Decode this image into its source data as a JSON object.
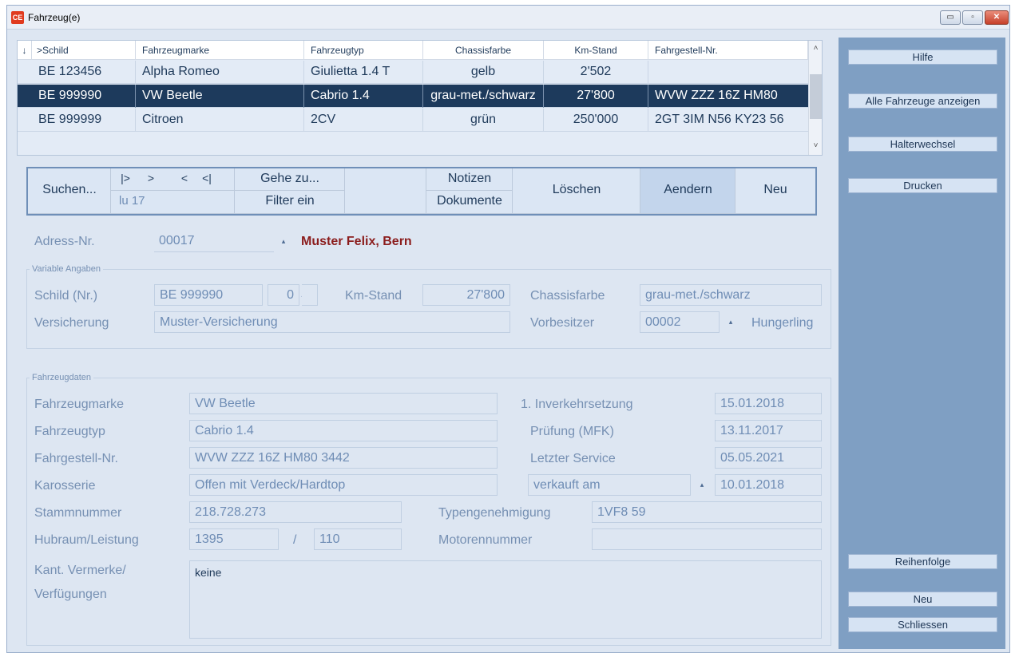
{
  "window": {
    "title": "Fahrzeug(e)",
    "icon": "app-logo-icon",
    "btn_min": "▭",
    "btn_max": "▫",
    "btn_close": "✕"
  },
  "grid": {
    "sort_indicator": "↓",
    "headers": [
      ">Schild",
      "Fahrzeugmarke",
      "Fahrzeugtyp",
      "Chassisfarbe",
      "Km-Stand",
      "Fahrgestell-Nr."
    ],
    "rows": [
      {
        "schild": "BE 123456",
        "marke": "Alpha Romeo",
        "typ": "Giulietta 1.4 T",
        "farbe": "gelb",
        "km": "2'502",
        "fgnr": ""
      },
      {
        "schild": "BE 999990",
        "marke": "VW Beetle",
        "typ": "Cabrio 1.4",
        "farbe": "grau-met./schwarz",
        "km": "27'800",
        "fgnr": "WVW ZZZ 16Z HM80"
      },
      {
        "schild": "BE 999999",
        "marke": "Citroen",
        "typ": "2CV",
        "farbe": "grün",
        "km": "250'000",
        "fgnr": "2GT 3IM N56 KY23 56"
      }
    ],
    "scroll_up": "˄",
    "scroll_down": "˅"
  },
  "toolbar": {
    "suchen": "Suchen...",
    "first": "|>",
    "next": ">",
    "prev": "<",
    "last": "<|",
    "record_info": "lu 17",
    "gehe_zu": "Gehe zu...",
    "filter": "Filter ein",
    "notizen": "Notizen",
    "dokumente": "Dokumente",
    "loeschen": "Löschen",
    "aendern": "Aendern",
    "neu": "Neu"
  },
  "address": {
    "label": "Adress-Nr.",
    "value": "00017",
    "name": "Muster Felix, Bern",
    "spin": "▴"
  },
  "variable": {
    "title": "Variable Angaben",
    "schild_label": "Schild (Nr.)",
    "schild_value": "BE 999990",
    "schild_suffix": "0",
    "schild_dash": "-",
    "km_label": "Km-Stand",
    "km_value": "27'800",
    "farbe_label": "Chassisfarbe",
    "farbe_value": "grau-met./schwarz",
    "versicherung_label": "Versicherung",
    "versicherung_value": "Muster-Versicherung",
    "vorbesitzer_label": "Vorbesitzer",
    "vorbesitzer_value": "00002",
    "vorbesitzer_name": "Hungerling",
    "spin": "▴"
  },
  "fahrzeug": {
    "title": "Fahrzeugdaten",
    "marke_label": "Fahrzeugmarke",
    "marke_value": "VW Beetle",
    "typ_label": "Fahrzeugtyp",
    "typ_value": "Cabrio 1.4",
    "fgnr_label": "Fahrgestell-Nr.",
    "fgnr_value": "WVW ZZZ 16Z HM80 3442",
    "karosserie_label": "Karosserie",
    "karosserie_value": "Offen mit Verdeck/Hardtop",
    "stamm_label": "Stammnummer",
    "stamm_value": "218.728.273",
    "hubraum_label": "Hubraum/Leistung",
    "hubraum_value": "1395",
    "slash": "/",
    "leistung_value": "110",
    "inverkehr_label": "1. Inverkehrsetzung",
    "inverkehr_value": "15.01.2018",
    "pruefung_label": "Prüfung (MFK)",
    "pruefung_value": "13.11.2017",
    "service_label": "Letzter Service",
    "service_value": "05.05.2021",
    "verkauft_value": "verkauft am",
    "verkauft_date": "10.01.2018",
    "spin": "▴",
    "typengen_label": "Typengenehmigung",
    "typengen_value": "1VF8 59",
    "motor_label": "Motorennummer",
    "motor_value": "",
    "vermerke_label1": "Kant. Vermerke/",
    "vermerke_label2": "Verfügungen",
    "vermerke_value": "keine"
  },
  "sidebar": {
    "hilfe": "Hilfe",
    "alle": "Alle Fahrzeuge anzeigen",
    "halterwechsel": "Halterwechsel",
    "drucken": "Drucken",
    "reihenfolge": "Reihenfolge",
    "neu": "Neu",
    "schliessen": "Schliessen"
  }
}
